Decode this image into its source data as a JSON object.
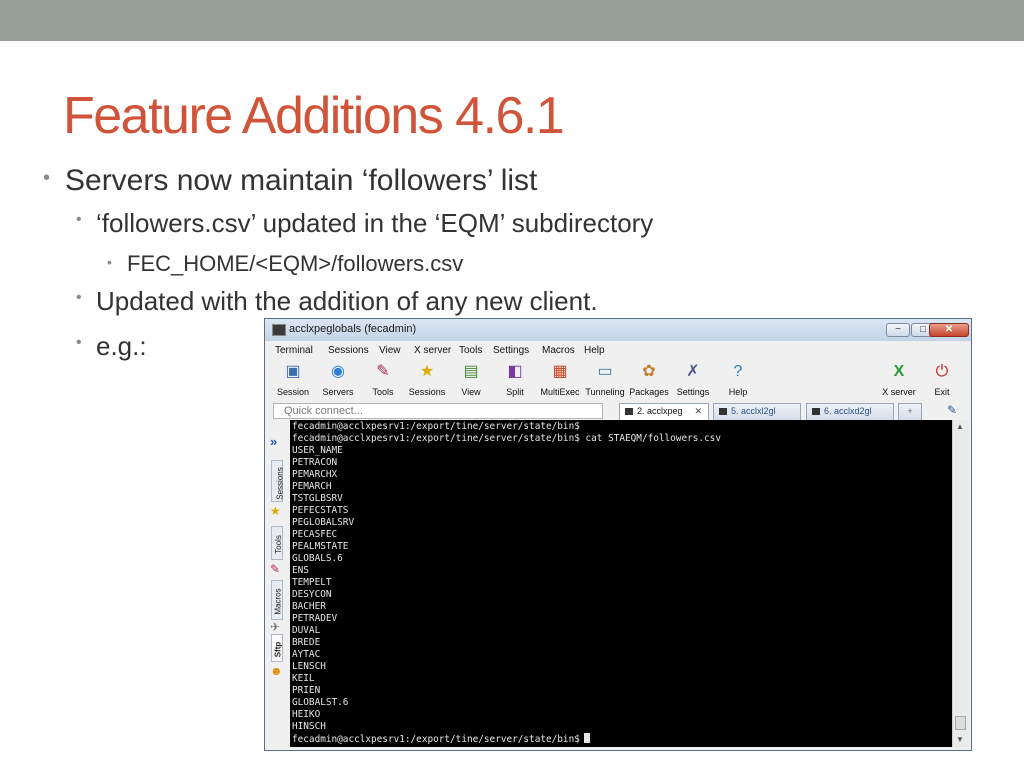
{
  "slide": {
    "title": "Feature Additions 4.6.1",
    "bullets": [
      {
        "text": "Servers now maintain ‘followers’ list"
      },
      {
        "text": "‘followers.csv’ updated in the ‘EQM’ subdirectory"
      },
      {
        "text": "FEC_HOME/<EQM>/followers.csv"
      },
      {
        "text": "Updated with the addition of any new client."
      },
      {
        "text": "e.g.:"
      }
    ],
    "bullet_glyph": "•",
    "colors": {
      "title": "#d0543a",
      "topbar": "#949f99"
    }
  },
  "window": {
    "title": "acclxpeglobals (fecadmin)",
    "minimize_glyph": "−",
    "maximize_glyph": "□",
    "close_glyph": "✕",
    "menu": [
      "Terminal",
      "Sessions",
      "View",
      "X server",
      "Tools",
      "Settings",
      "Macros",
      "Help"
    ],
    "toolbar": [
      {
        "label": "Session",
        "icon": "session-icon"
      },
      {
        "label": "Servers",
        "icon": "servers-icon"
      },
      {
        "label": "Tools",
        "icon": "tools-icon"
      },
      {
        "label": "Sessions",
        "icon": "sessions-icon"
      },
      {
        "label": "View",
        "icon": "view-icon"
      },
      {
        "label": "Split",
        "icon": "split-icon"
      },
      {
        "label": "MultiExec",
        "icon": "multiexec-icon"
      },
      {
        "label": "Tunneling",
        "icon": "tunneling-icon"
      },
      {
        "label": "Packages",
        "icon": "packages-icon"
      },
      {
        "label": "Settings",
        "icon": "settings-icon"
      },
      {
        "label": "Help",
        "icon": "help-icon"
      },
      {
        "label": "X server",
        "icon": "x-server-icon"
      },
      {
        "label": "Exit",
        "icon": "exit-icon"
      }
    ],
    "quick_connect_placeholder": "Quick connect...",
    "tabs": [
      {
        "label": "2. acclxpeg"
      },
      {
        "label": "5. acclxl2gl"
      },
      {
        "label": "6. acclxd2gl"
      }
    ],
    "tab_close_glyph": "✕",
    "side_tabs": [
      "Sessions",
      "Tools",
      "Macros",
      "Sftp"
    ],
    "terminal_lines": [
      "fecadmin@acclxpesrv1:/export/tine/server/state/bin$",
      "fecadmin@acclxpesrv1:/export/tine/server/state/bin$ cat STAEQM/followers.csv",
      "USER_NAME",
      "PETRACON",
      "PEMARCHX",
      "PEMARCH",
      "TSTGLBSRV",
      "PEFECSTATS",
      "PEGLOBALSRV",
      "PECASFEC",
      "PEALMSTATE",
      "GLOBALS.6",
      "ENS",
      "TEMPELT",
      "DESYCON",
      "BACHER",
      "PETRADEV",
      "DUVAL",
      "BREDE",
      "AYTAC",
      "LENSCH",
      "KEIL",
      "PRIEN",
      "GLOBALST.6",
      "HEIKO",
      "HINSCH"
    ],
    "prompt_line": "fecadmin@acclxpesrv1:/export/tine/server/state/bin$"
  }
}
